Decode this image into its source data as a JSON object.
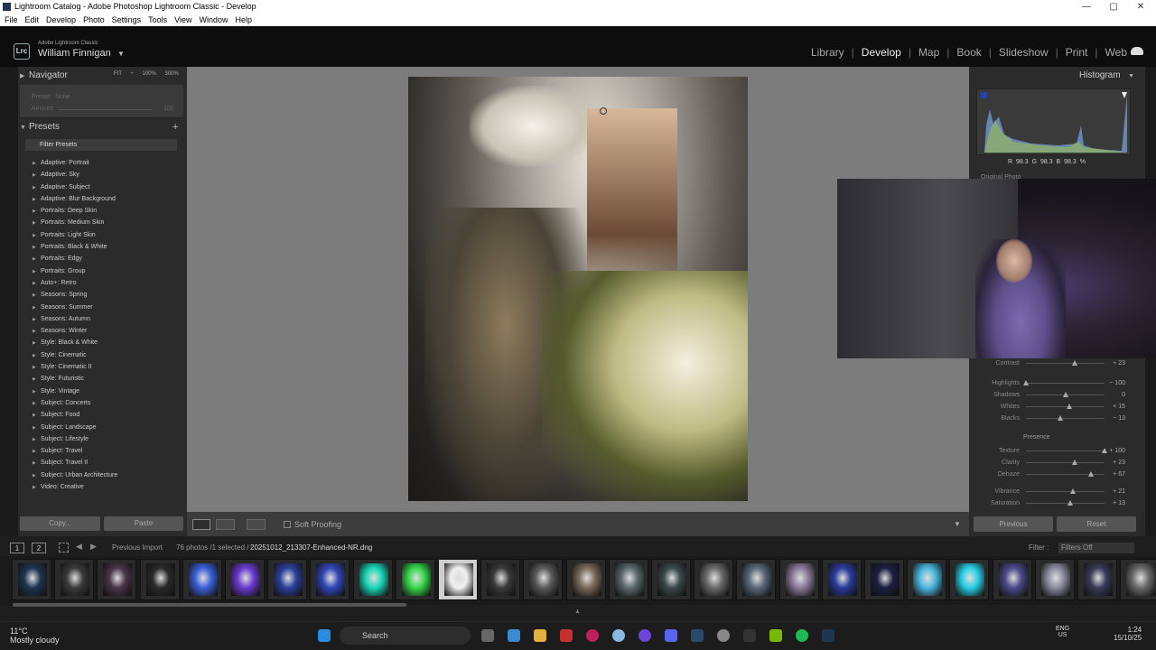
{
  "window": {
    "title": "Lightroom Catalog - Adobe Photoshop Lightroom Classic - Develop"
  },
  "menu": [
    "File",
    "Edit",
    "Develop",
    "Photo",
    "Settings",
    "Tools",
    "View",
    "Window",
    "Help"
  ],
  "identity": {
    "badge": "Lrc",
    "sub": "Adobe Lightroom Classic",
    "name": "William Finnigan",
    "caret": "▼"
  },
  "modules": [
    {
      "label": "Library",
      "active": false
    },
    {
      "label": "Develop",
      "active": true
    },
    {
      "label": "Map",
      "active": false
    },
    {
      "label": "Book",
      "active": false
    },
    {
      "label": "Slideshow",
      "active": false
    },
    {
      "label": "Print",
      "active": false
    },
    {
      "label": "Web",
      "active": false
    }
  ],
  "navigator": {
    "title": "Navigator",
    "zoom": "FIT ÷ 100% 300% ÷",
    "preset_label": "Preset : None",
    "amount_label": "Amount",
    "amount_value": "100"
  },
  "presets": {
    "title": "Presets",
    "filter": "Filter Presets",
    "items": [
      "Adaptive: Portrait",
      "Adaptive: Sky",
      "Adaptive: Subject",
      "Adaptive: Blur Background",
      "Portraits: Deep Skin",
      "Portraits: Medium Skin",
      "Portraits: Light Skin",
      "Portraits: Black & White",
      "Portraits: Edgy",
      "Portraits: Group",
      "Auto+: Retro",
      "Seasons: Spring",
      "Seasons: Summer",
      "Seasons: Autumn",
      "Seasons: Winter",
      "Style: Black & White",
      "Style: Cinematic",
      "Style: Cinematic II",
      "Style: Futuristic",
      "Style: Vintage",
      "Subject: Concerts",
      "Subject: Food",
      "Subject: Landscape",
      "Subject: Lifestyle",
      "Subject: Travel",
      "Subject: Travel II",
      "Subject: Urban Architecture",
      "Video: Creative"
    ]
  },
  "left_buttons": {
    "copy": "Copy...",
    "paste": "Paste"
  },
  "toolbar": {
    "soft_proofing": "Soft Proofing"
  },
  "histogram": {
    "title": "Histogram",
    "readout": "R 98.3 G 98.3 B 98.3 %",
    "original_photo": "Original Photo"
  },
  "sliders": [
    {
      "name": "Contrast",
      "value": "+ 23",
      "level": 0.62
    },
    {
      "name": "Highlights",
      "value": "− 100",
      "level": 0.0
    },
    {
      "name": "Shadows",
      "value": "0",
      "level": 0.5
    },
    {
      "name": "Whites",
      "value": "+ 15",
      "level": 0.55
    },
    {
      "name": "Blacks",
      "value": "− 13",
      "level": 0.44
    },
    {
      "name": "Texture",
      "value": "+ 100",
      "level": 1.0
    },
    {
      "name": "Clarity",
      "value": "+ 23",
      "level": 0.62
    },
    {
      "name": "Dehaze",
      "value": "+ 67",
      "level": 0.83
    },
    {
      "name": "Vibrance",
      "value": "+ 21",
      "level": 0.6
    },
    {
      "name": "Saturation",
      "value": "+ 13",
      "level": 0.56
    }
  ],
  "presence_label": "Presence",
  "right_buttons": {
    "previous": "Previous",
    "reset": "Reset"
  },
  "filmstrip": {
    "view1": "1",
    "view2": "2",
    "source": "Previous Import",
    "count": "76 photos /1 selected /",
    "filename": "20251012_213307-Enhanced-NR.dng",
    "filter_label": "Filter :",
    "filter_value": "Filters Off",
    "thumb_colors": [
      "#1d3550",
      "#3a3a3a",
      "#4a3548",
      "#2a2a2a",
      "#3a5fd8",
      "#6a3ad0",
      "#2b3f9a",
      "#2f46b8",
      "#18d8b8",
      "#35d84a",
      "#f0f0f0",
      "#3a3a3a",
      "#5a5a5a",
      "#7a6a5a",
      "#5a6a6a",
      "#3a4a4a",
      "#6a6a6a",
      "#5a6a7a",
      "#8a7a9a",
      "#2a3a9a",
      "#1a1f40",
      "#4ab8e0",
      "#28d0e8",
      "#4a4a8a",
      "#8a8aa0",
      "#3a3a5a",
      "#6a6a6a"
    ]
  },
  "taskbar": {
    "temp": "11°C",
    "weather": "Mostly cloudy",
    "search": "Search",
    "lang1": "ENG",
    "lang2": "US",
    "time": "1:24",
    "date": "15/10/25"
  }
}
